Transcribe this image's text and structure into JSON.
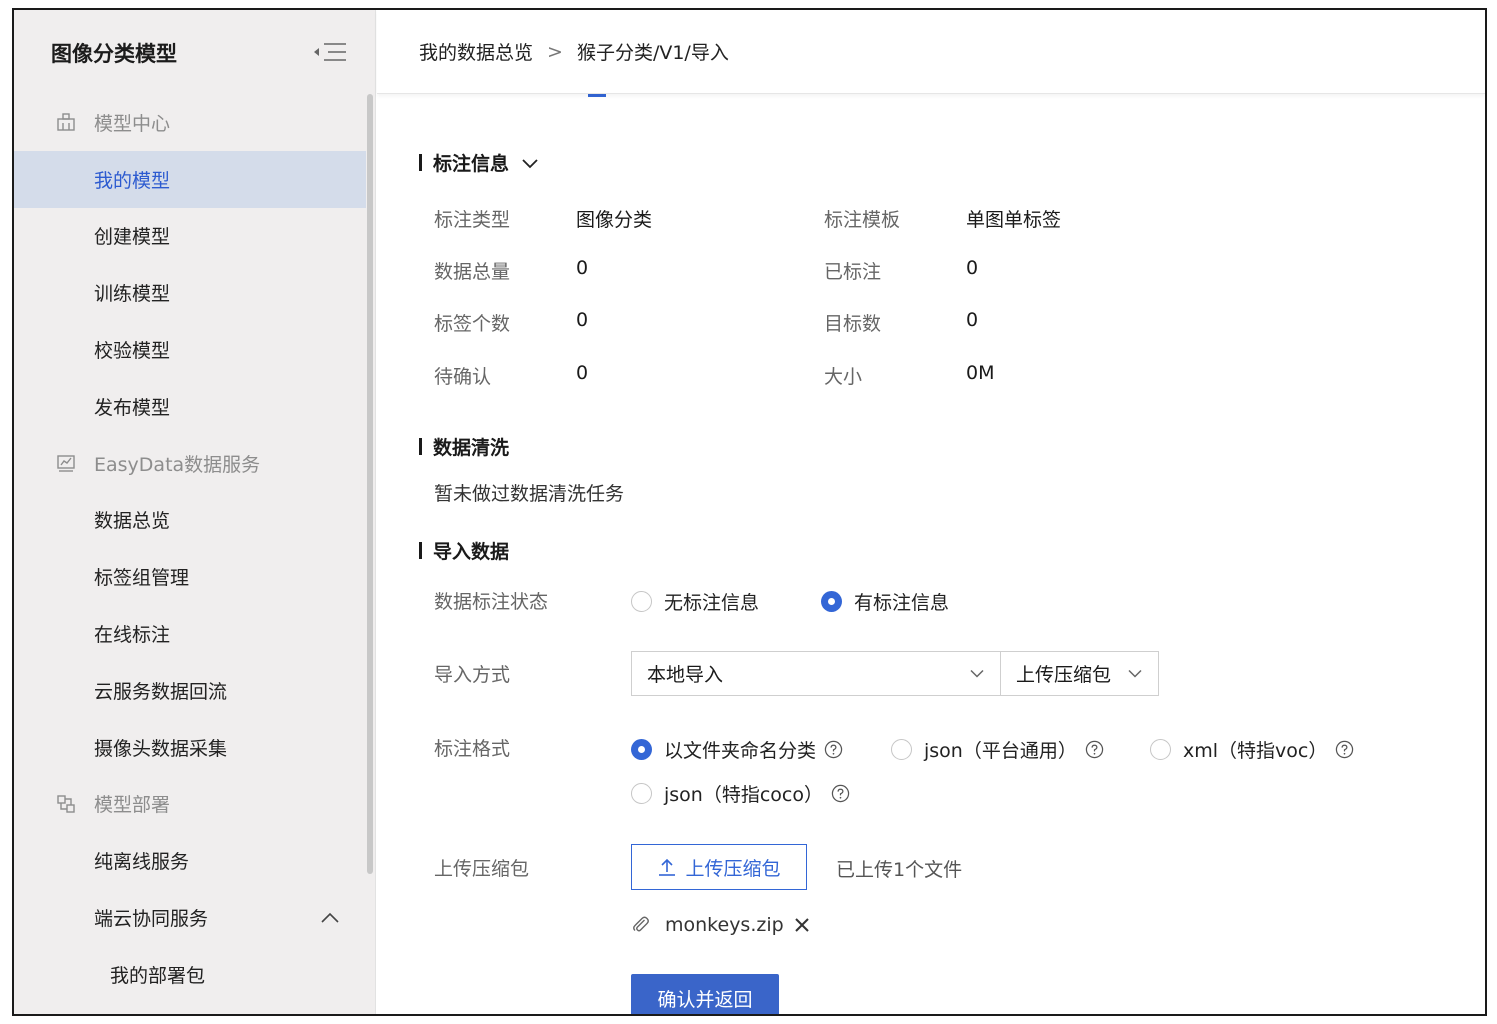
{
  "sidebar": {
    "title": "图像分类模型",
    "items": [
      {
        "label": "模型中心",
        "type": "group",
        "icon": "model-center-icon"
      },
      {
        "label": "我的模型",
        "type": "sub",
        "active": true
      },
      {
        "label": "创建模型",
        "type": "sub"
      },
      {
        "label": "训练模型",
        "type": "sub"
      },
      {
        "label": "校验模型",
        "type": "sub"
      },
      {
        "label": "发布模型",
        "type": "sub"
      },
      {
        "label": "EasyData数据服务",
        "type": "group",
        "icon": "chart-icon"
      },
      {
        "label": "数据总览",
        "type": "sub"
      },
      {
        "label": "标签组管理",
        "type": "sub"
      },
      {
        "label": "在线标注",
        "type": "sub"
      },
      {
        "label": "云服务数据回流",
        "type": "sub"
      },
      {
        "label": "摄像头数据采集",
        "type": "sub"
      },
      {
        "label": "模型部署",
        "type": "group",
        "icon": "deploy-icon"
      },
      {
        "label": "纯离线服务",
        "type": "sub"
      },
      {
        "label": "端云协同服务",
        "type": "sub",
        "expanded": true
      },
      {
        "label": "我的部署包",
        "type": "sub2"
      }
    ]
  },
  "breadcrumb": {
    "first": "我的数据总览",
    "separator": ">",
    "second": "猴子分类/V1/导入"
  },
  "annotation_info": {
    "title": "标注信息",
    "fields": [
      {
        "key": "标注类型",
        "value": "图像分类"
      },
      {
        "key": "标注模板",
        "value": "单图单标签"
      },
      {
        "key": "数据总量",
        "value": "0"
      },
      {
        "key": "已标注",
        "value": "0"
      },
      {
        "key": "标签个数",
        "value": "0"
      },
      {
        "key": "目标数",
        "value": "0"
      },
      {
        "key": "待确认",
        "value": "0"
      },
      {
        "key": "大小",
        "value": "0M"
      }
    ]
  },
  "data_cleaning": {
    "title": "数据清洗",
    "text": "暂未做过数据清洗任务"
  },
  "import_data": {
    "title": "导入数据",
    "status_label": "数据标注状态",
    "status_options": [
      {
        "label": "无标注信息",
        "selected": false
      },
      {
        "label": "有标注信息",
        "selected": true
      }
    ],
    "method_label": "导入方式",
    "method_value": "本地导入",
    "method_sub_value": "上传压缩包",
    "format_label": "标注格式",
    "format_options": [
      {
        "label": "以文件夹命名分类",
        "selected": true
      },
      {
        "label": "json（平台通用）",
        "selected": false
      },
      {
        "label": "xml（特指voc）",
        "selected": false
      },
      {
        "label": "json（特指coco）",
        "selected": false
      }
    ],
    "upload_label": "上传压缩包",
    "upload_button": "上传压缩包",
    "uploaded_text": "已上传1个文件",
    "file_name": "monkeys.zip",
    "confirm_button": "确认并返回"
  },
  "colors": {
    "accent": "#3366d6",
    "sidebar_bg": "#f0eeee",
    "active_item_bg": "#d4dcea"
  }
}
